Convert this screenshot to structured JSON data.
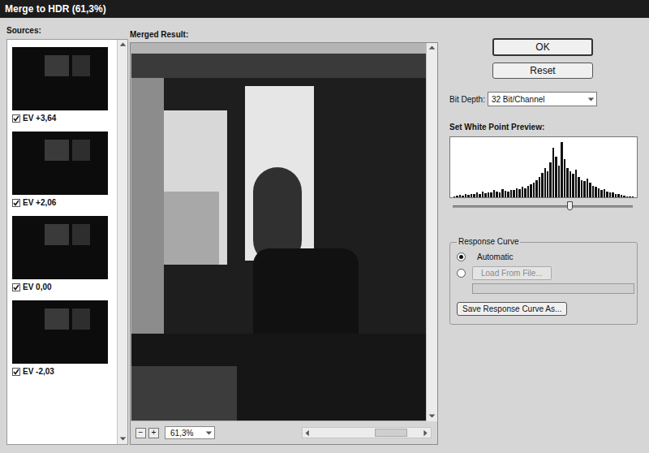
{
  "window": {
    "title": "Merge to HDR (61,3%)"
  },
  "sources": {
    "label": "Sources:",
    "items": [
      {
        "label": "EV +3,64",
        "checked": true
      },
      {
        "label": "EV +2,06",
        "checked": true
      },
      {
        "label": "EV 0,00",
        "checked": true
      },
      {
        "label": "EV -2,03",
        "checked": true
      }
    ]
  },
  "merged": {
    "label": "Merged Result:",
    "zoom_out": "−",
    "zoom_in": "+",
    "zoom": "61,3%"
  },
  "buttons": {
    "ok": "OK",
    "reset": "Reset"
  },
  "bit_depth": {
    "label": "Bit Depth:",
    "value": "32 Bit/Channel"
  },
  "white_point": {
    "label": "Set White Point Preview:",
    "histogram": [
      2,
      3,
      4,
      3,
      5,
      4,
      6,
      5,
      8,
      6,
      10,
      7,
      9,
      8,
      12,
      10,
      9,
      14,
      11,
      10,
      13,
      12,
      15,
      14,
      18,
      16,
      20,
      22,
      25,
      30,
      35,
      42,
      50,
      45,
      60,
      85,
      70,
      55,
      95,
      65,
      50,
      45,
      40,
      48,
      35,
      30,
      28,
      32,
      25,
      20,
      18,
      15,
      12,
      14,
      10,
      8,
      9,
      6,
      5,
      4,
      3,
      2,
      2,
      1
    ],
    "level": 0.65
  },
  "response_curve": {
    "label": "Response Curve",
    "options": [
      {
        "label": "Automatic",
        "selected": true,
        "kind": "text",
        "disabled": false
      },
      {
        "label": "Load From File...",
        "selected": false,
        "kind": "button",
        "disabled": true
      }
    ],
    "path": "",
    "save": "Save Response Curve As..."
  }
}
